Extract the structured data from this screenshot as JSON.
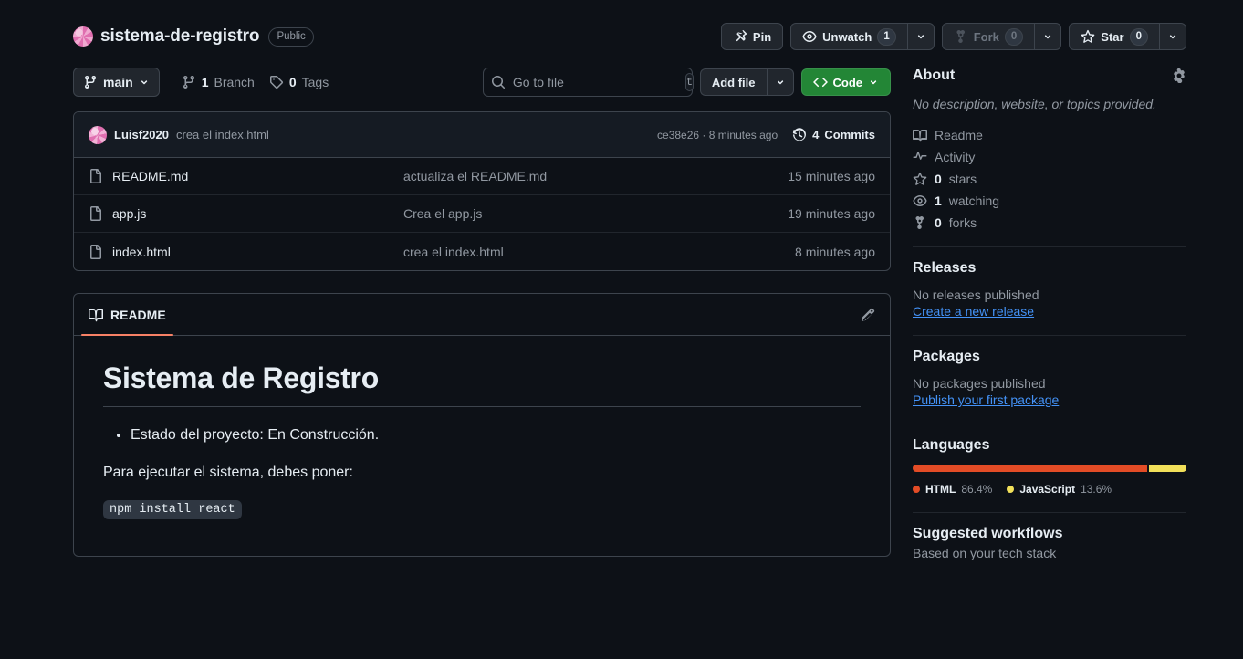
{
  "repo": {
    "owner_avatar": "owner-avatar",
    "name": "sistema-de-registro",
    "visibility": "Public"
  },
  "header_actions": {
    "pin_label": "Pin",
    "watch_label": "Unwatch",
    "watch_count": "1",
    "fork_label": "Fork",
    "fork_count": "0",
    "star_label": "Star",
    "star_count": "0"
  },
  "toolbar": {
    "branch_label": "main",
    "branches_count": "1",
    "branches_label": "Branch",
    "tags_count": "0",
    "tags_label": "Tags",
    "search_placeholder": "Go to file",
    "search_value": "",
    "search_kbd": "t",
    "add_file_label": "Add file",
    "code_label": "Code"
  },
  "commit_bar": {
    "author": "Luisf2020",
    "message": "crea el index.html",
    "sha": "ce38e26",
    "separator": "·",
    "relative_time": "8 minutes ago",
    "commits_count": "4",
    "commits_label": "Commits"
  },
  "files": [
    {
      "icon": "file-icon",
      "name": "README.md",
      "commit_message": "actualiza el README.md",
      "time": "15 minutes ago"
    },
    {
      "icon": "file-icon",
      "name": "app.js",
      "commit_message": "Crea el app.js",
      "time": "19 minutes ago"
    },
    {
      "icon": "file-icon",
      "name": "index.html",
      "commit_message": "crea el index.html",
      "time": "8 minutes ago"
    }
  ],
  "readme": {
    "tab_label": "README",
    "heading": "Sistema de Registro",
    "bullet_1": "Estado del proyecto: En Construcción.",
    "paragraph": "Para ejecutar el sistema, debes poner:",
    "code": "npm install react"
  },
  "about": {
    "title": "About",
    "description": "No description, website, or topics provided.",
    "items": [
      {
        "icon": "book-icon",
        "label": "Readme"
      },
      {
        "icon": "pulse-icon",
        "label": "Activity"
      },
      {
        "icon": "star-icon",
        "count": "0",
        "label": "stars"
      },
      {
        "icon": "eye-icon",
        "count": "1",
        "label": "watching"
      },
      {
        "icon": "fork-icon",
        "count": "0",
        "label": "forks"
      }
    ]
  },
  "releases": {
    "title": "Releases",
    "empty_text": "No releases published",
    "link_label": "Create a new release"
  },
  "packages": {
    "title": "Packages",
    "empty_text": "No packages published",
    "link_label": "Publish your first package"
  },
  "languages": {
    "title": "Languages",
    "items": [
      {
        "name": "HTML",
        "percent": "86.4%",
        "color": "#e34c26",
        "width": 86.4
      },
      {
        "name": "JavaScript",
        "percent": "13.6%",
        "color": "#f1e05a",
        "width": 13.6
      }
    ]
  },
  "workflows": {
    "title": "Suggested workflows",
    "subtitle": "Based on your tech stack"
  },
  "colors": {
    "page_bg": "#0d1117",
    "border": "#3d444d",
    "accent_green": "#238636",
    "accent_link": "#4493f8",
    "tab_underline": "#f78166",
    "muted": "#9198a1"
  }
}
